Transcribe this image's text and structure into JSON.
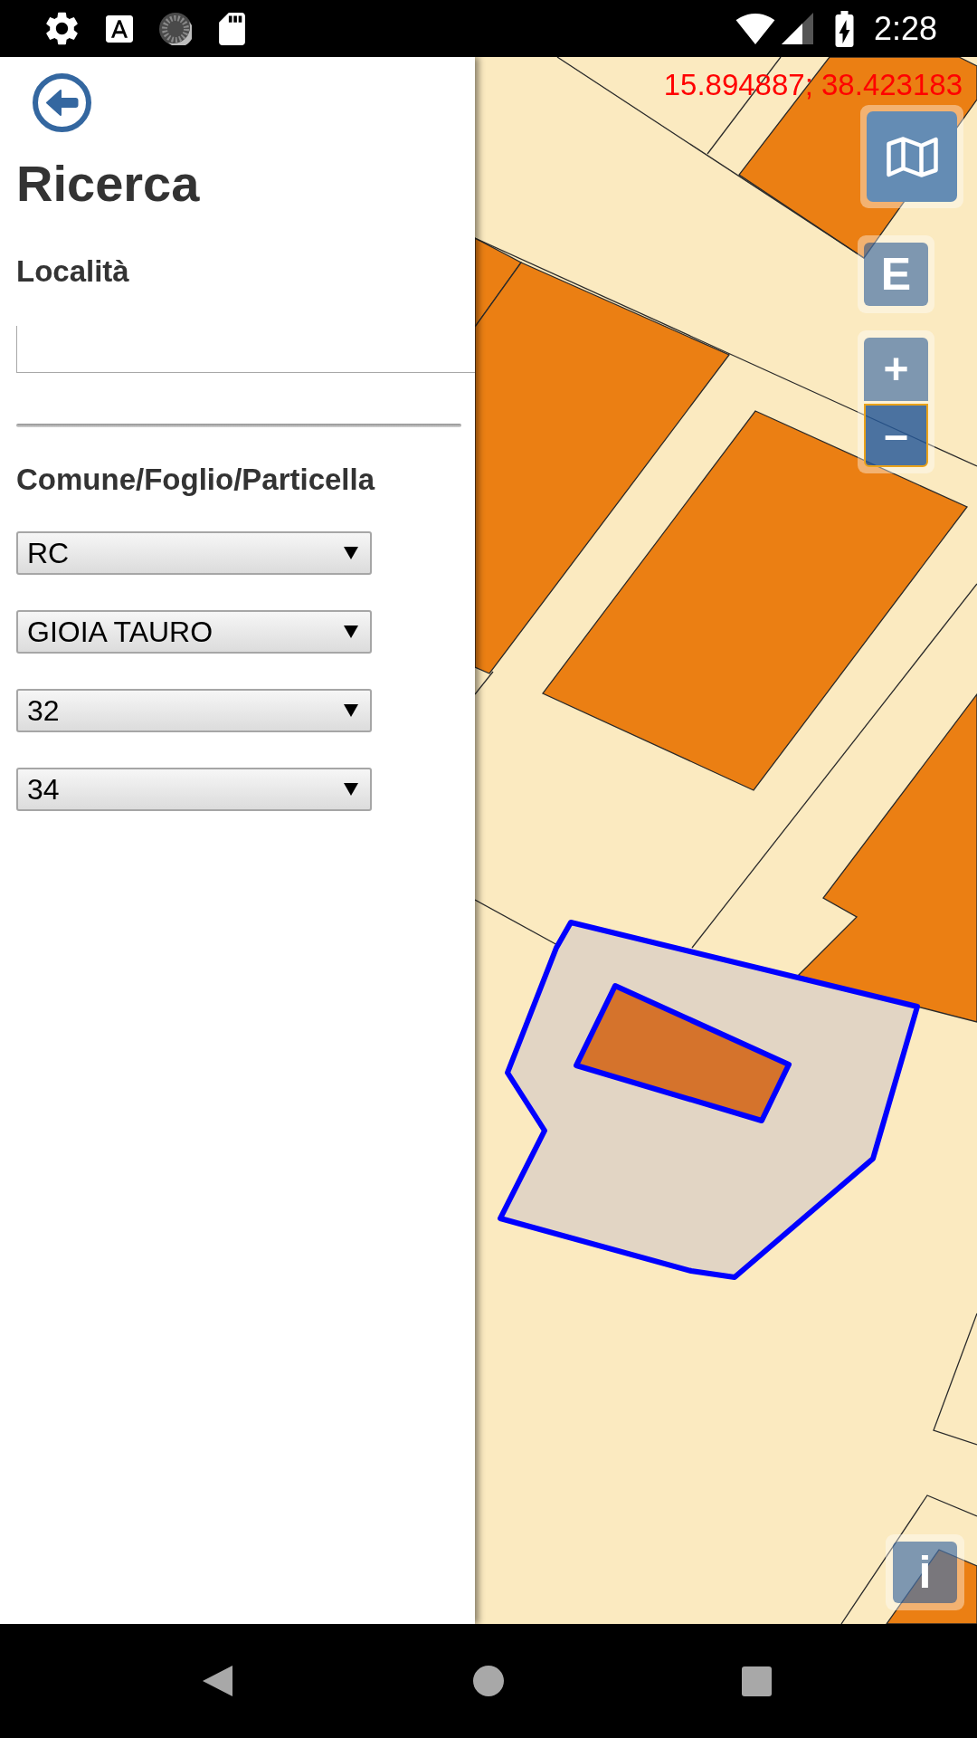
{
  "status_bar": {
    "time": "2:28"
  },
  "search_panel": {
    "title": "Ricerca",
    "locality": {
      "label": "Località"
    },
    "cadastre": {
      "label": "Comune/Foglio/Particella",
      "selects": [
        {
          "value": "RC"
        },
        {
          "value": "GIOIA TAURO"
        },
        {
          "value": "32"
        },
        {
          "value": "34"
        }
      ]
    }
  },
  "map": {
    "coordinates": "15.894887; 38.423183",
    "letter_button": {
      "label": "E"
    },
    "zoom": [
      {
        "label": "+",
        "focused": false
      },
      {
        "label": "–",
        "focused": true
      }
    ],
    "info_button": {
      "label": "i"
    }
  }
}
